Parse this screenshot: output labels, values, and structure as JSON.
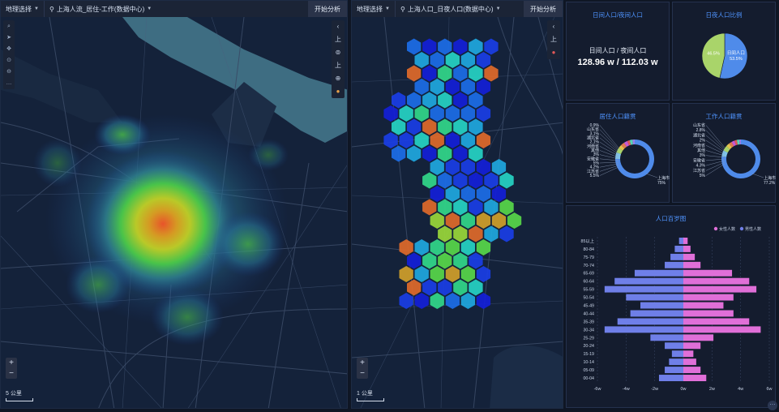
{
  "left_map": {
    "geo_select": "地理选择",
    "layer": "上海人流_居住-工作(数据中心)",
    "start_button": "开始分析",
    "scale": "5 公里",
    "tools": [
      "⌕",
      "➤",
      "✥",
      "⊙",
      "⊖",
      "…"
    ],
    "right_tools": [
      "‹",
      "上",
      "⊚",
      "上",
      "⊕",
      "●"
    ]
  },
  "right_map": {
    "geo_select": "地理选择",
    "layer": "上海人口_日夜人口(数据中心)",
    "start_button": "开始分析",
    "scale": "1 公里",
    "tools": [
      "⌕",
      "➤",
      "✥",
      "⊙",
      "⊖",
      "…"
    ],
    "right_tools": [
      "‹",
      "上",
      "●"
    ]
  },
  "day_night_panel": {
    "title": "日间人口/夜间人口",
    "label": "日间人口 / 夜间人口",
    "value": "128.96 w / 112.03 w"
  },
  "ratio_panel": {
    "title": "日夜人口比例",
    "chart_data": {
      "type": "pie",
      "slices": [
        {
          "label": "日间人口",
          "value": 53.5,
          "text": "日间人口\n53.5%",
          "color": "#4f8bea"
        },
        {
          "label": "",
          "value": 46.5,
          "text": "46.5%",
          "color": "#a9d46a"
        }
      ]
    }
  },
  "residence_panel": {
    "title": "居住人口籍贯",
    "chart_data": {
      "type": "pie",
      "center_label": "上海市",
      "center_value": "75%",
      "slices": [
        {
          "label": "上海市",
          "value": 75,
          "color": "#4f8bea"
        },
        {
          "label": "江苏省",
          "value": 5.5,
          "color": "#7fc4ea"
        },
        {
          "label": "",
          "value": 4.2,
          "color": "#a9d46a"
        },
        {
          "label": "其他",
          "value": 3,
          "color": "#e0c24e"
        },
        {
          "label": "安徽省",
          "value": 3,
          "color": "#e07a4e"
        },
        {
          "label": "河南省",
          "value": 3,
          "color": "#c55ad4"
        },
        {
          "label": "湖北省",
          "value": 2.1,
          "color": "#e25858"
        },
        {
          "label": "山东省",
          "value": 2.4,
          "color": "#58d4b5"
        },
        {
          "label": "浙江省",
          "value": 1.8,
          "color": "#9a7ee8"
        }
      ],
      "labels_left": [
        "0.9%",
        "山东省",
        "3.1%",
        "湖北省",
        "2.1%",
        "河南省",
        "其他",
        "3%",
        "安徽省",
        "5%",
        "4.2%",
        "江苏省",
        "5.5%"
      ]
    }
  },
  "work_panel": {
    "title": "工作人口籍贯",
    "chart_data": {
      "type": "pie",
      "center_label": "上海市",
      "center_value": "77.2%",
      "slices": [
        {
          "label": "上海市",
          "value": 77.2,
          "color": "#4f8bea"
        },
        {
          "label": "江苏省",
          "value": 5,
          "color": "#7fc4ea"
        },
        {
          "label": "",
          "value": 4.3,
          "color": "#a9d46a"
        },
        {
          "label": "其他",
          "value": 3,
          "color": "#e0c24e"
        },
        {
          "label": "安徽省",
          "value": 2.5,
          "color": "#e07a4e"
        },
        {
          "label": "河南省",
          "value": 2.6,
          "color": "#c55ad4"
        },
        {
          "label": "湖北省",
          "value": 2,
          "color": "#e25858"
        },
        {
          "label": "山东省",
          "value": 2,
          "color": "#58d4b5"
        },
        {
          "label": "浙江省",
          "value": 1.4,
          "color": "#9a7ee8"
        }
      ],
      "labels_left": [
        "山东省",
        "2.8%",
        "湖北省",
        "2%",
        "河南省",
        "其他",
        "3%",
        "安徽省",
        "4.3%",
        "江苏省",
        "5%"
      ]
    }
  },
  "pyramid_panel": {
    "title": "人口百岁图",
    "legend_female": "女性人数",
    "legend_male": "男性人数",
    "chart_data": {
      "type": "bar",
      "orientation": "horizontal-diverging",
      "categories": [
        "85以上",
        "80-84",
        "75-79",
        "70-74",
        "65-69",
        "60-64",
        "55-59",
        "50-54",
        "45-49",
        "40-44",
        "35-39",
        "30-34",
        "25-29",
        "20-24",
        "15-19",
        "10-14",
        "05-09",
        "00-04"
      ],
      "series": [
        {
          "name": "男性人数",
          "values": [
            0.3,
            0.6,
            0.9,
            1.3,
            3.4,
            4.8,
            5.5,
            4.0,
            3.0,
            3.7,
            4.6,
            5.5,
            2.3,
            1.3,
            0.8,
            1.0,
            1.3,
            1.7
          ],
          "color": "#6f7fe8"
        },
        {
          "name": "女性人数",
          "values": [
            0.3,
            0.5,
            0.8,
            1.2,
            3.4,
            4.6,
            5.1,
            3.5,
            2.8,
            3.5,
            4.6,
            5.4,
            2.1,
            1.2,
            0.7,
            0.9,
            1.2,
            1.6
          ],
          "color": "#e06fd8"
        }
      ],
      "x_ticks": [
        "-6w",
        "-4w",
        "-2w",
        "0w",
        "2w",
        "4w",
        "6w"
      ],
      "xlim": [
        -6,
        6
      ]
    }
  }
}
